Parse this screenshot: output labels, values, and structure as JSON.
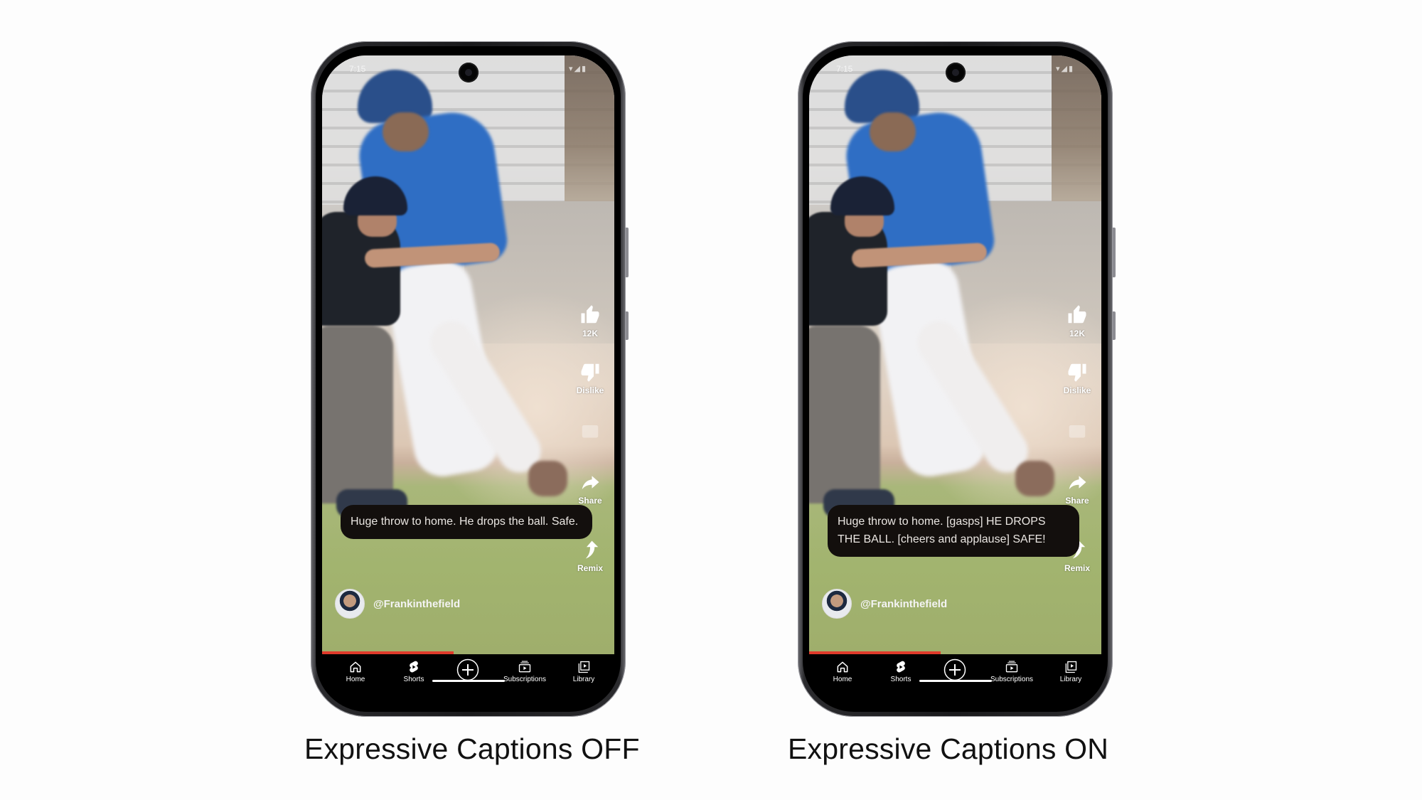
{
  "slide": {
    "phones": [
      {
        "id": "off",
        "status_time": "7:15",
        "status_icons": [
          "wifi-icon",
          "signal-icon",
          "battery-icon"
        ],
        "actions": {
          "like_count": "12K",
          "dislike_label": "Dislike",
          "share_label": "Share",
          "remix_label": "Remix"
        },
        "caption": "Huge throw to home. He drops the ball. Safe.",
        "channel_handle": "@Frankinthefield",
        "progress_percent": 45,
        "nav": [
          "Home",
          "Shorts",
          "Create",
          "Subscriptions",
          "Library"
        ],
        "title": "Expressive Captions OFF"
      },
      {
        "id": "on",
        "status_time": "7:15",
        "status_icons": [
          "wifi-icon",
          "signal-icon",
          "battery-icon"
        ],
        "actions": {
          "like_count": "12K",
          "dislike_label": "Dislike",
          "share_label": "Share",
          "remix_label": "Remix"
        },
        "caption": "Huge throw to home. [gasps] HE DROPS THE BALL. [cheers and applause] SAFE!",
        "channel_handle": "@Frankinthefield",
        "progress_percent": 45,
        "nav": [
          "Home",
          "Shorts",
          "Create",
          "Subscriptions",
          "Library"
        ],
        "title": "Expressive Captions ON"
      }
    ],
    "colors": {
      "progress": "#e03a2a",
      "caption_bg": "#130f0d",
      "nav_bg": "#000000"
    }
  }
}
